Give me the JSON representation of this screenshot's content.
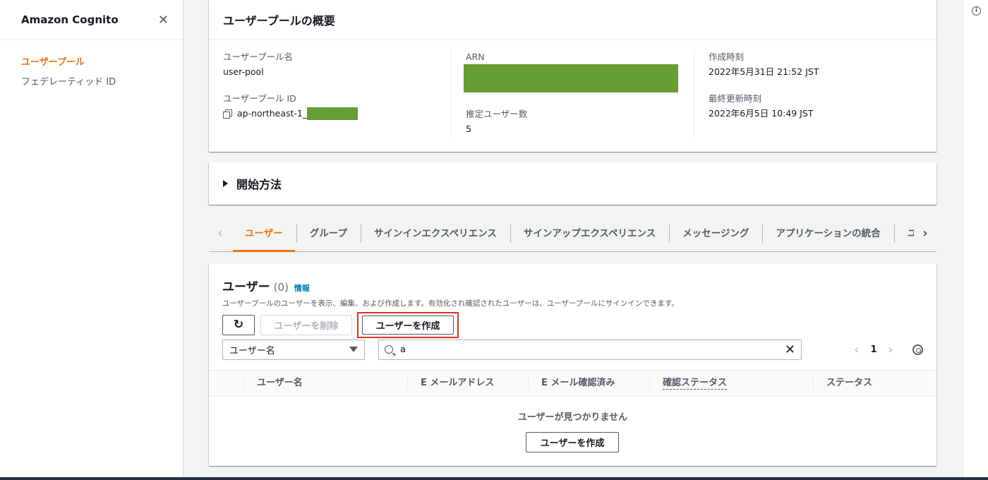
{
  "sidebar": {
    "title": "Amazon Cognito",
    "items": [
      {
        "label": "ユーザープール",
        "active": true
      },
      {
        "label": "フェデレーティッド ID",
        "active": false
      }
    ]
  },
  "overview": {
    "title": "ユーザープールの概要",
    "pool_name_label": "ユーザープール名",
    "pool_name": "user-pool",
    "pool_id_label": "ユーザープール ID",
    "pool_id_prefix": "ap-northeast-1_",
    "arn_label": "ARN",
    "estimated_users_label": "推定ユーザー数",
    "estimated_users": "5",
    "created_label": "作成時刻",
    "created": "2022年5月31日 21:52 JST",
    "updated_label": "最終更新時刻",
    "updated": "2022年6月5日 10:49 JST",
    "redaction_color": "#669d34"
  },
  "getting_started": {
    "title": "開始方法"
  },
  "tabs": [
    {
      "label": "ユーザー",
      "active": true
    },
    {
      "label": "グループ"
    },
    {
      "label": "サインインエクスペリエンス"
    },
    {
      "label": "サインアップエクスペリエンス"
    },
    {
      "label": "メッセージング"
    },
    {
      "label": "アプリケーションの統合"
    },
    {
      "label": "ユー"
    }
  ],
  "users": {
    "title": "ユーザー",
    "count": "(0)",
    "info_link": "情報",
    "description": "ユーザープールのユーザーを表示、編集、および作成します。有効化され確認されたユーザーは、ユーザープールにサインインできます。",
    "refresh_icon": "refresh-icon",
    "delete_label": "ユーザーを削除",
    "create_label": "ユーザーを作成",
    "filter_select": "ユーザー名",
    "search_value": "a",
    "page": "1",
    "columns": [
      "ユーザー名",
      "E メールアドレス",
      "E メール確認済み",
      "確認ステータス",
      "ステータス"
    ],
    "empty_text": "ユーザーが見つかりません",
    "empty_create_label": "ユーザーを作成"
  },
  "colors": {
    "accent": "#ec7211",
    "link": "#0073bb",
    "highlight": "#e0321c"
  }
}
